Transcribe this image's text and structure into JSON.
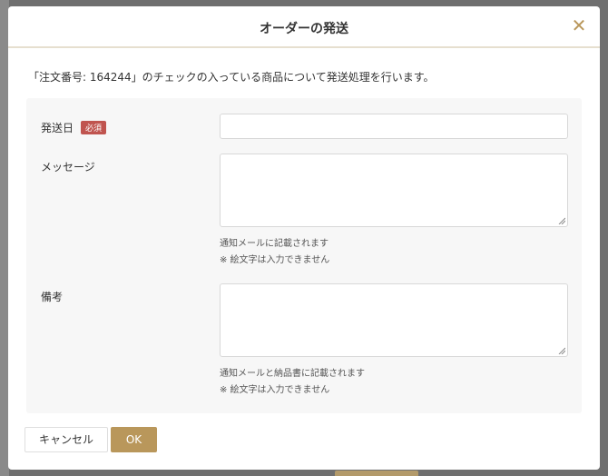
{
  "modal": {
    "title": "オーダーの発送",
    "close_icon": "close-icon"
  },
  "intro_text": "「注文番号: 164244」のチェックの入っている商品について発送処理を行います。",
  "form": {
    "ship_date": {
      "label": "発送日",
      "required_badge": "必須",
      "value": ""
    },
    "message": {
      "label": "メッセージ",
      "value": "",
      "hint1": "通知メールに記載されます",
      "hint2": "※ 絵文字は入力できません"
    },
    "remarks": {
      "label": "備考",
      "value": "",
      "hint1": "通知メールと納品書に記載されます",
      "hint2": "※ 絵文字は入力できません"
    }
  },
  "buttons": {
    "cancel": "キャンセル",
    "ok": "OK"
  },
  "colors": {
    "accent": "#b9975b",
    "required": "#c0544f",
    "panel": "#f7f7f7",
    "backdrop": "#6f6f6f"
  }
}
